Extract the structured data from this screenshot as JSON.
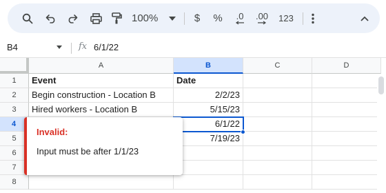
{
  "toolbar": {
    "zoom": "100%",
    "currency": "$",
    "percent": "%",
    "decrease_decimal": ".0",
    "increase_decimal": ".00",
    "number_format": "123",
    "icons": [
      "search-icon",
      "undo-icon",
      "redo-icon",
      "print-icon",
      "paint-format-icon",
      "chevron-down-icon",
      "more-vert-icon",
      "collapse-icon"
    ]
  },
  "formula_bar": {
    "cell_ref": "B4",
    "fx": "fx",
    "value": "6/1/22"
  },
  "columns": [
    "A",
    "B",
    "C",
    "D"
  ],
  "active_column": "B",
  "rows": [
    "1",
    "2",
    "3",
    "4",
    "5",
    "6",
    "7",
    "8"
  ],
  "active_row": "4",
  "cells": {
    "A1": "Event",
    "B1": "Date",
    "A2": "Begin construction - Location B",
    "B2": "2/2/23",
    "A3": "Hired workers - Location B",
    "B3": "5/15/23",
    "B4": "6/1/22",
    "B5": "7/19/23"
  },
  "validation_popup": {
    "title": "Invalid:",
    "message": "Input must be after 1/1/23",
    "accent_color": "#d93025"
  },
  "colors": {
    "toolbar_bg": "#edf2fa",
    "selection": "#0b57d0",
    "active_header_bg": "#d3e3fd"
  }
}
